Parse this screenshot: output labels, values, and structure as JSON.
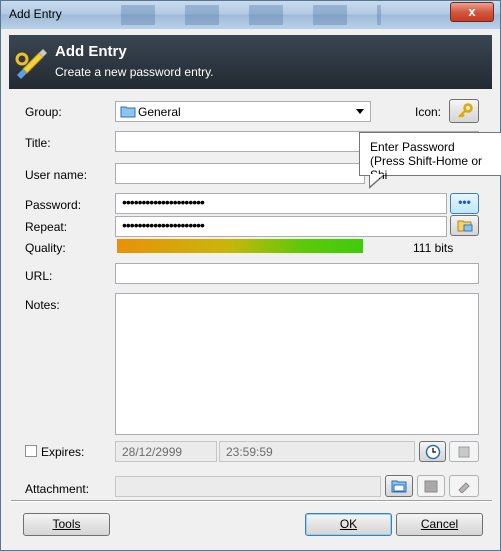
{
  "window": {
    "title": "Add Entry",
    "close_label": "x"
  },
  "banner": {
    "title": "Add Entry",
    "subtitle": "Create a new password entry.",
    "icon": "key-pen-icon"
  },
  "labels": {
    "group": "Group:",
    "icon": "Icon:",
    "title": "Title:",
    "username": "User name:",
    "password": "Password:",
    "repeat": "Repeat:",
    "quality": "Quality:",
    "url": "URL:",
    "notes": "Notes:",
    "expires": "Expires:",
    "attachment": "Attachment:"
  },
  "fields": {
    "group": "General",
    "title": "",
    "username": "",
    "password": "•••••••••••••••••••••",
    "repeat": "•••••••••••••••••••••",
    "url": "",
    "notes": "",
    "expires_date": "28/12/2999",
    "expires_time": "23:59:59",
    "attachment": ""
  },
  "quality": {
    "text": "111 bits",
    "fraction": 0.65
  },
  "tooltip": {
    "line1": "Enter Password",
    "line2": "(Press Shift-Home or Shi"
  },
  "buttons": {
    "tools": "Tools",
    "ok": "OK",
    "cancel": "Cancel",
    "show_password": "•••"
  },
  "expires_checked": false
}
